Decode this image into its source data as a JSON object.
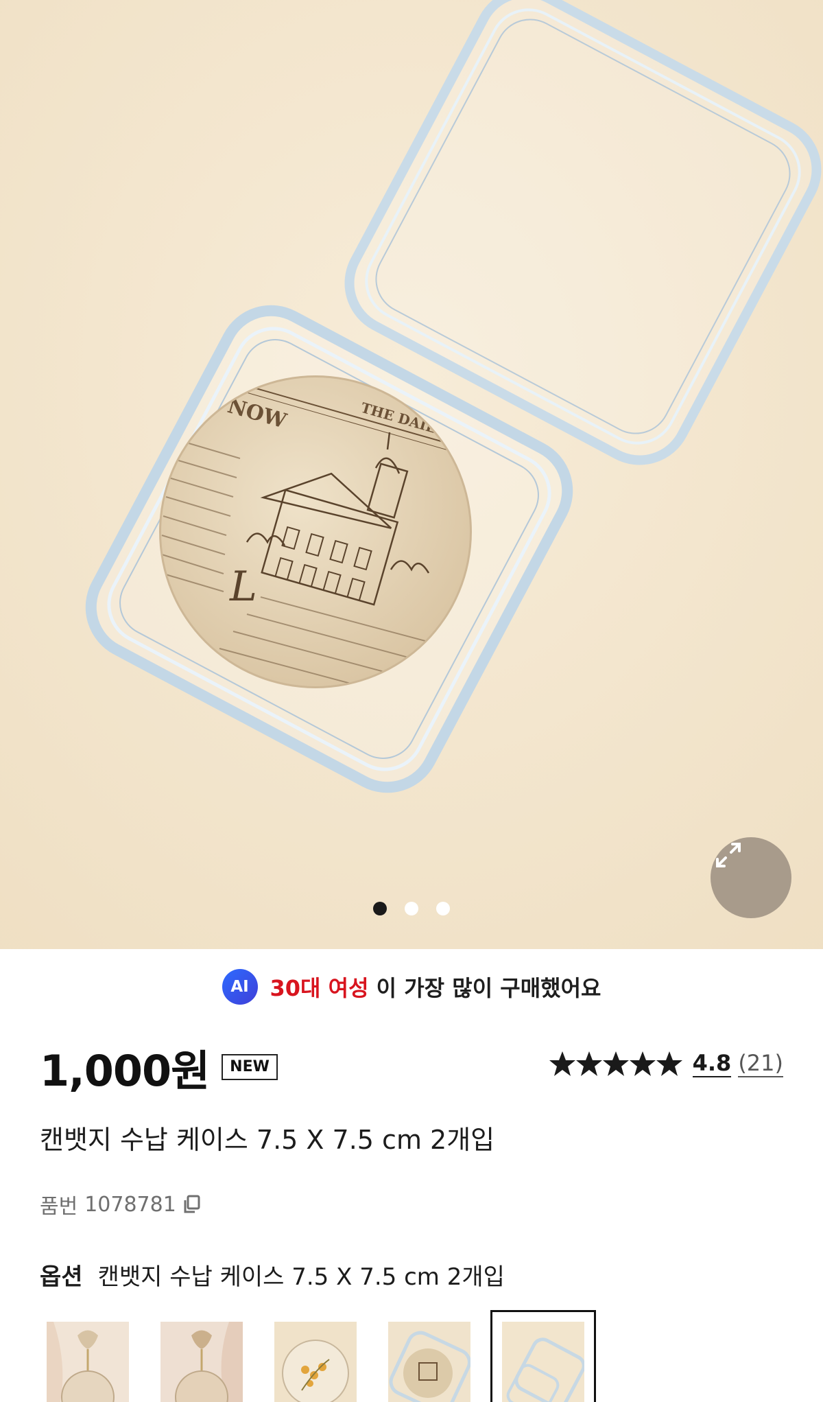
{
  "gallery": {
    "dots_total": 3,
    "active_dot": 0,
    "expand_icon": "expand-arrows-icon",
    "badge_text_lines": [
      "NOW",
      "THE DAILY NEWS PA",
      "L"
    ]
  },
  "ai_banner": {
    "badge": "AI",
    "highlight": "30대 여성",
    "text": " 이 가장 많이 구매했어요"
  },
  "product": {
    "price": "1,000원",
    "new_badge": "NEW",
    "rating": "4.8",
    "review_count": "(21)",
    "stars": 5,
    "title": "캔뱃지 수납 케이스 7.5 X 7.5 cm 2개입",
    "sku_label": "품번",
    "sku": "1078781"
  },
  "option": {
    "label": "옵션",
    "value": "캔뱃지 수납 케이스 7.5 X 7.5 cm 2개입"
  },
  "colors": {
    "background": "#f4e7d0",
    "accent_red": "#d8141e",
    "ai_blue": "#2d6bff"
  }
}
